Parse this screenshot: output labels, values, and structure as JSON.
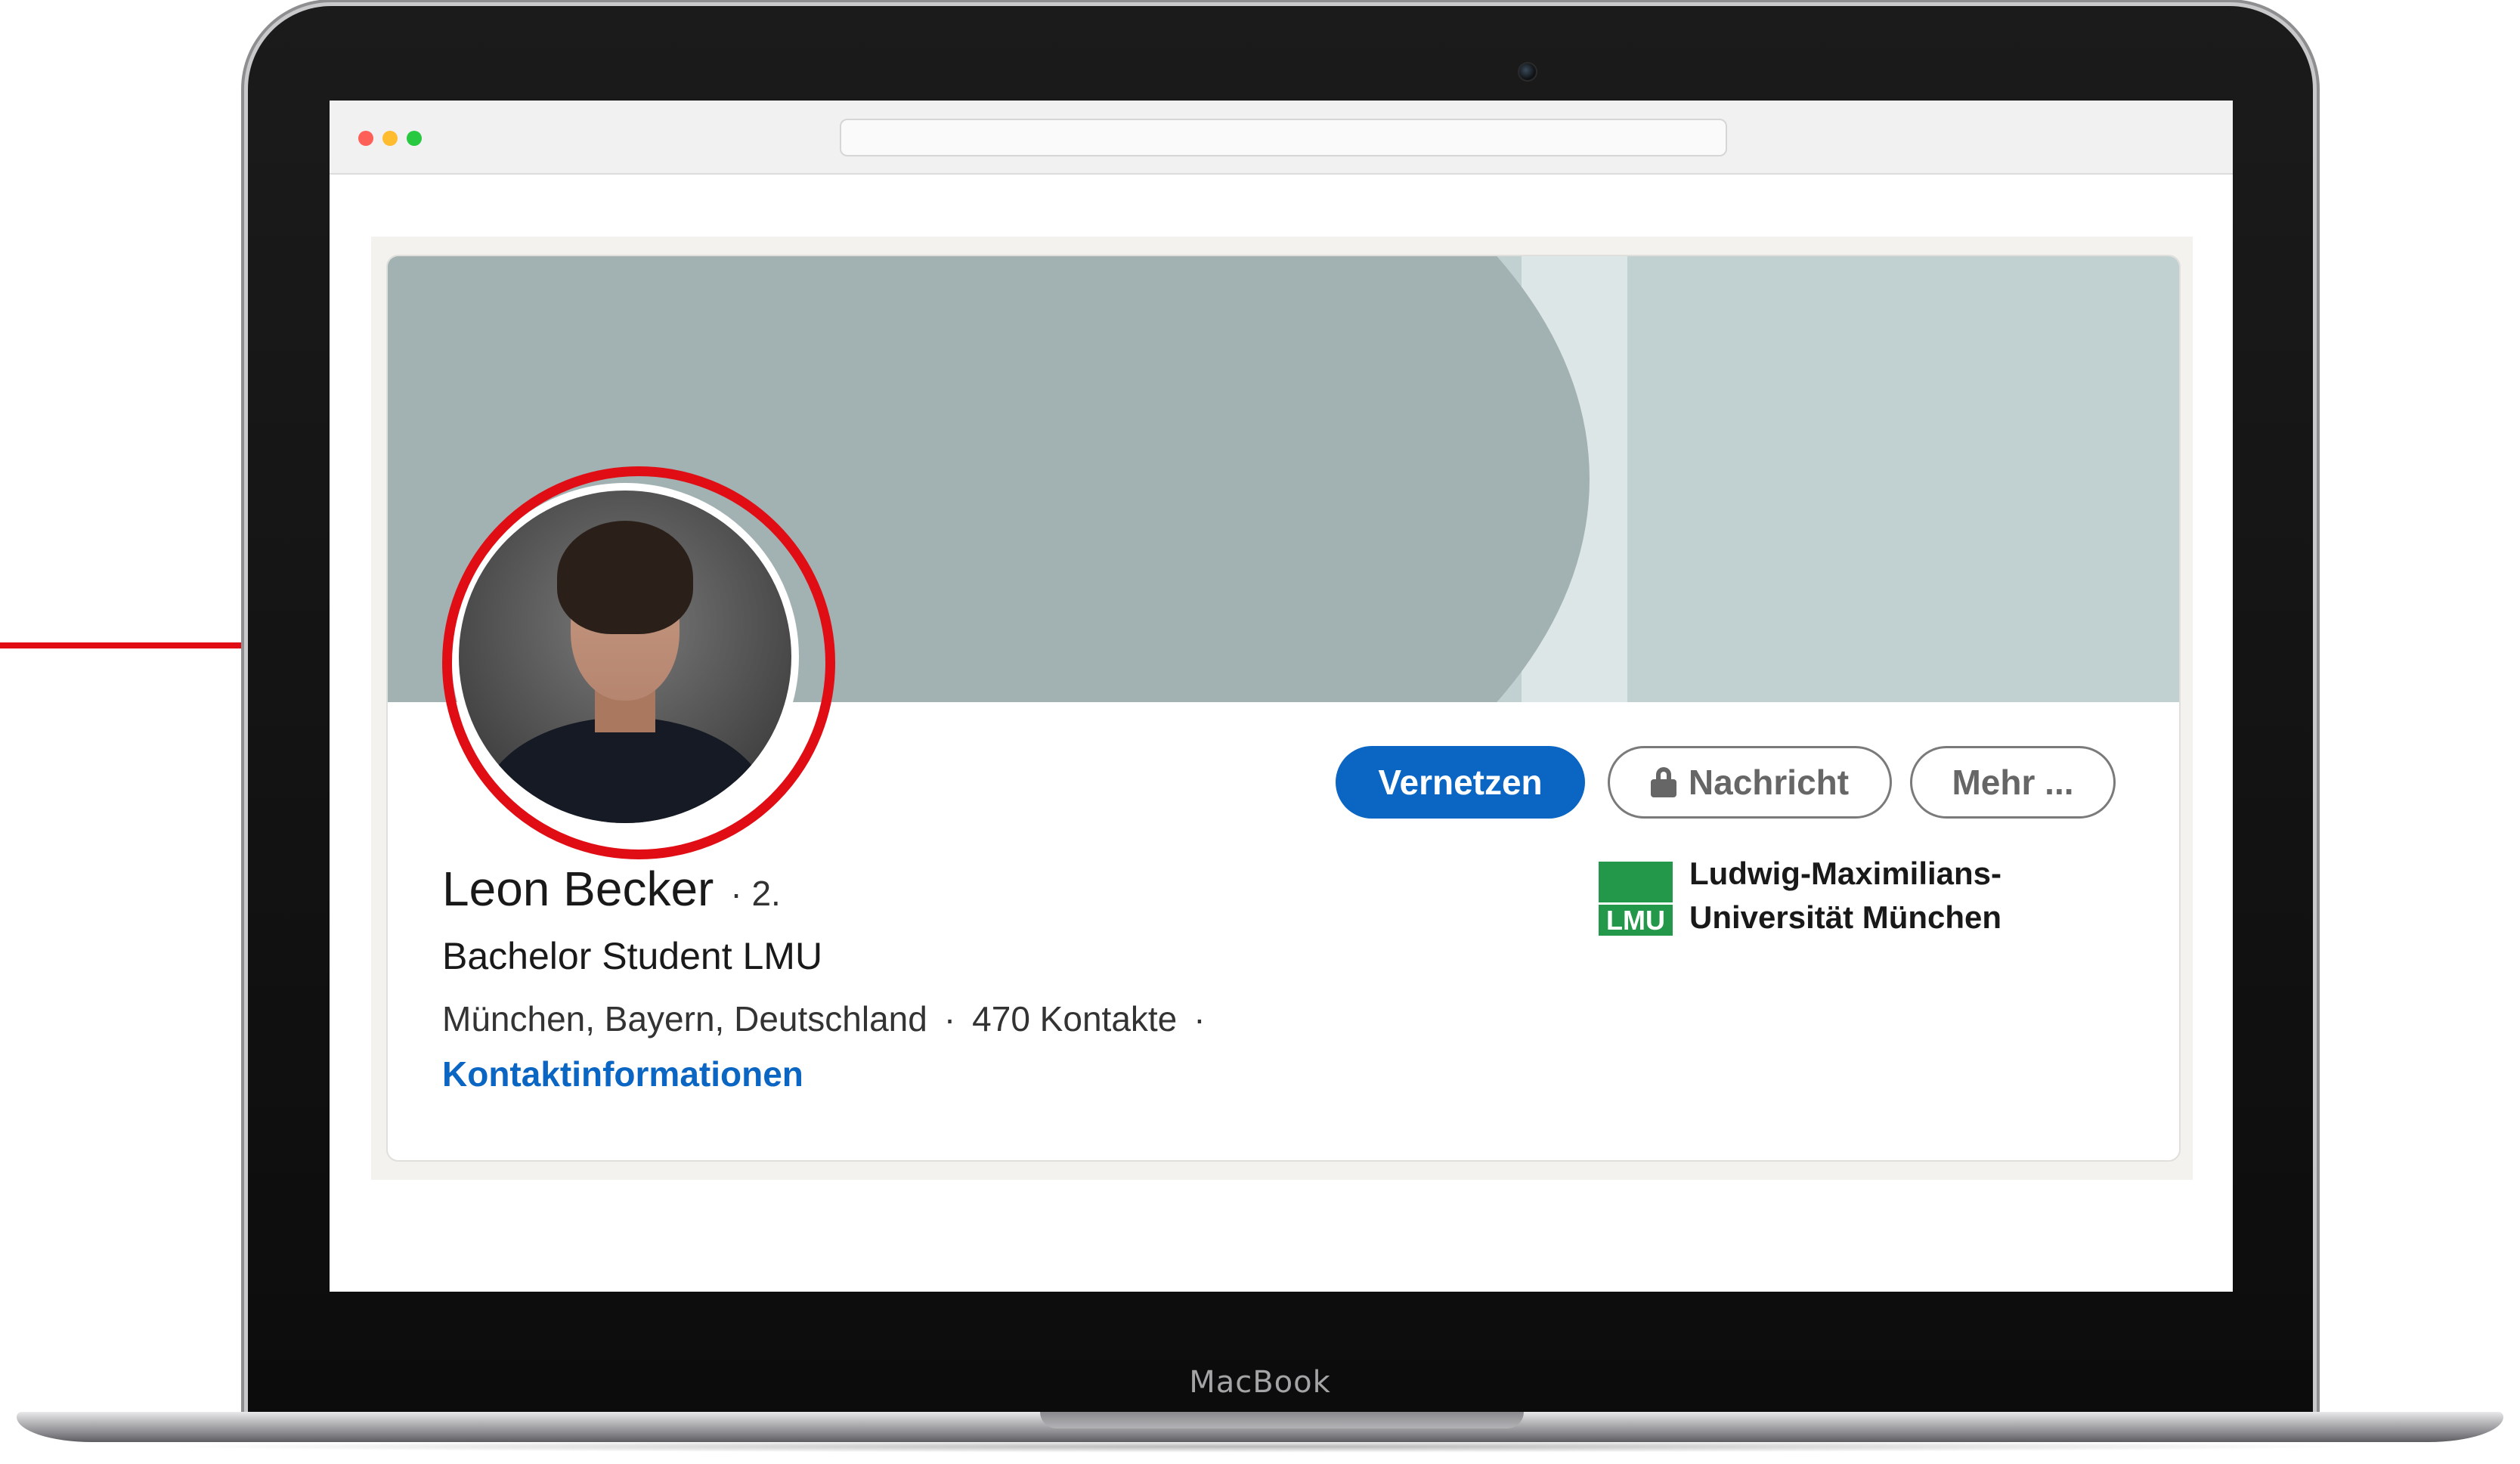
{
  "device": {
    "label": "MacBook"
  },
  "browser": {
    "url": ""
  },
  "profile": {
    "name": "Leon Becker",
    "degree": "· 2.",
    "headline": "Bachelor Student LMU",
    "location": "München, Bayern, Deutschland",
    "connections": "470 Kontakte",
    "separator": "·",
    "contact_info_label": "Kontaktinformationen"
  },
  "actions": {
    "connect_label": "Vernetzen",
    "message_label": "Nachricht",
    "more_label": "Mehr ..."
  },
  "education": {
    "logo_text": "LMU",
    "name_line1": "Ludwig-Maximilians-",
    "name_line2": "Universität München"
  },
  "colors": {
    "accent": "#0a66c2",
    "highlight": "#e00d14",
    "banner": "#c1d1d2",
    "university_green": "#23974a"
  },
  "icons": {
    "message_button": "lock-icon",
    "camera": "camera-icon"
  }
}
